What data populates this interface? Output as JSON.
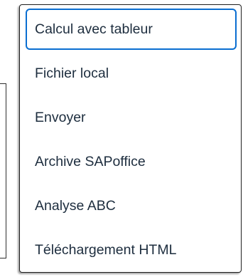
{
  "menu": {
    "items": [
      {
        "label": "Calcul avec tableur",
        "focused": true
      },
      {
        "label": "Fichier local",
        "focused": false
      },
      {
        "label": "Envoyer",
        "focused": false
      },
      {
        "label": "Archive SAPoffice",
        "focused": false
      },
      {
        "label": "Analyse ABC",
        "focused": false
      },
      {
        "label": "Téléchargement HTML",
        "focused": false
      }
    ]
  },
  "colors": {
    "text": "#1d2d3e",
    "focus_border": "#0a6ed1",
    "menu_border": "#1f1f1f",
    "background": "#ffffff"
  }
}
